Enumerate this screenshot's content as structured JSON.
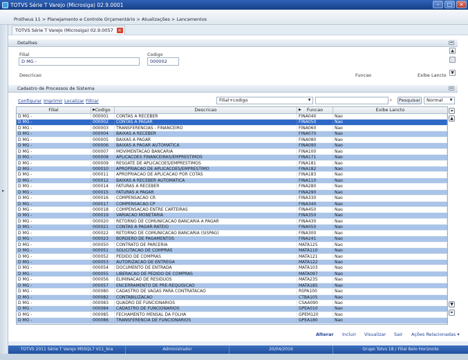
{
  "window": {
    "title": "TOTVS Série T Varejo (Microsiga) 02.9.0001"
  },
  "breadcrumb": "Protheus 11 > Planejamento e Controle Orçamentário > Atualizações > Lancamentos",
  "tab": {
    "label": "TOTVS Série T Varejo (Microsiga) 02.9.0057"
  },
  "detalhes": {
    "title": "Detalhes",
    "filial_label": "Filial",
    "filial_value": "D MG    -",
    "codigo_label": "Codigo",
    "codigo_value": "000002",
    "descricao_label": "Descricao",
    "funcao_label": "Funcao",
    "exibe_label": "Exibe Lancto"
  },
  "cadastro": {
    "title": "Cadastro de Processos de Sistema",
    "links": [
      "Configurar",
      "Imprimir",
      "Localizar",
      "Filtrar"
    ],
    "sort_select": "Filial+codigo",
    "search_value": "",
    "search_button": "Pesquisar",
    "view_select": "Normal"
  },
  "grid": {
    "columns": [
      "Filial",
      "Codigo",
      "Descricao",
      "Funcao",
      "Exibe Lancto"
    ],
    "rows": [
      [
        "D MG    -",
        "000001",
        "CONTAS A RECEBER",
        "FINA040",
        "Nao"
      ],
      [
        "D MG    -",
        "000002",
        "CONTAS A PAGAR",
        "FINA050",
        "Nao"
      ],
      [
        "D MG    -",
        "000003",
        "TRANSFERENCIAS - FINANCEIRO",
        "FINA060",
        "Nao"
      ],
      [
        "D MG    -",
        "000004",
        "BAIXAS A RECEBER",
        "FINA070",
        "Nao"
      ],
      [
        "D MG    -",
        "000005",
        "BAIXAS A PAGAR",
        "FINA080",
        "Nao"
      ],
      [
        "D MG    -",
        "000006",
        "BAIXAS A PAGAR AUTOMATICA",
        "FINA090",
        "Nao"
      ],
      [
        "D MG    -",
        "000007",
        "MOVIMENTACAO BANCARIA",
        "FINA100",
        "Nao"
      ],
      [
        "D MG    -",
        "000008",
        "APLICACOES FINANCEIRAS/EMPRESTIMOS",
        "FINA171",
        "Nao"
      ],
      [
        "D MG    -",
        "000009",
        "RESGATE DE APLICACOES/EMPRESTIMOS",
        "FINA181",
        "Nao"
      ],
      [
        "D MG    -",
        "000010",
        "APROPRIACAO DE APLICACOES/EMPRESTIMO",
        "FINA182",
        "Nao"
      ],
      [
        "D MG    -",
        "000011",
        "APROPRIACAO DE APLICACAO POR COTAS",
        "FINA183",
        "Nao"
      ],
      [
        "D MG    -",
        "000012",
        "BAIXAS A RECEBER AUTOMATICA",
        "FINA110",
        "Nao"
      ],
      [
        "D MG    -",
        "000014",
        "FATURAS A RECEBER",
        "FINA280",
        "Nao"
      ],
      [
        "D MG    -",
        "000015",
        "FATURAS A PAGAR",
        "FINA290",
        "Nao"
      ],
      [
        "D MG    -",
        "000016",
        "COMPENSACAO CR",
        "FINA330",
        "Nao"
      ],
      [
        "D MG    -",
        "000017",
        "COMPENSACAO CP",
        "FINA340",
        "Nao"
      ],
      [
        "D MG    -",
        "000018",
        "COMPENSACAO ENTRE CARTEIRAS",
        "FINA450",
        "Nao"
      ],
      [
        "D MG    -",
        "000019",
        "VARIACAO MONETARIA",
        "FINA350",
        "Nao"
      ],
      [
        "D MG    -",
        "000020",
        "RETORNO DE COMUNICACAO BANCARIA A PAGAR",
        "FINA430",
        "Nao"
      ],
      [
        "D MG    -",
        "000021",
        "CONTAS A PAGAR-RATEIO",
        "FINA050",
        "Nao"
      ],
      [
        "D MG    -",
        "000022",
        "RETORNO DE COMUNICACAO BANCARIA (SISPAG)",
        "FINA300",
        "Nao"
      ],
      [
        "D MG    -",
        "000023",
        "BORDERO DE PAGAMENTOS",
        "FINA241",
        "Nao"
      ],
      [
        "D MG    -",
        "000050",
        "CONTRATO DE PARCERIA",
        "MATA125",
        "Nao"
      ],
      [
        "D MG    -",
        "000051",
        "SOLICITACAO DE COMPRAS",
        "MATA110",
        "Nao"
      ],
      [
        "D MG    -",
        "000052",
        "PEDIDO DE COMPRAS",
        "MATA121",
        "Nao"
      ],
      [
        "D MG    -",
        "000053",
        "AUTORIZACAO DE ENTREGA",
        "MATA122",
        "Nao"
      ],
      [
        "D MG    -",
        "000054",
        "DOCUMENTO DE ENTRADA",
        "MATA103",
        "Nao"
      ],
      [
        "D MG    -",
        "000055",
        "LIBERACAO DE PEDIDO DE COMPRAS",
        "MATA097",
        "Nao"
      ],
      [
        "D MG    -",
        "000056",
        "ELIMINACAO DE RESIDUOS",
        "MATA235",
        "Nao"
      ],
      [
        "D MG    -",
        "000057",
        "ENCERRAMENTO DE PRE-REQUISICAO",
        "MATA185",
        "Nao"
      ],
      [
        "D MG    -",
        "000080",
        "CADASTRO DE VAGAS PARA CONTRATACAO",
        "RSPA100",
        "Nao"
      ],
      [
        "D MG    -",
        "000082",
        "CONTABILIZACAO",
        "CTBA105",
        "Nao"
      ],
      [
        "D MG    -",
        "000083",
        "QUADRO DE FUNCIONARIOS",
        "CSAA090",
        "Nao"
      ],
      [
        "D MG    -",
        "000084",
        "CADASTRO DE FUNCIONARIOS",
        "GPEA010",
        "Nao"
      ],
      [
        "D MG    -",
        "000085",
        "FECHAMENTO MENSAL DA FOLHA",
        "GPEM120",
        "Nao"
      ],
      [
        "D MG    -",
        "000086",
        "TRANSFERENCIA DE FUNCIONARIOS",
        "GPEA180",
        "Nao"
      ]
    ],
    "selected_row": 1
  },
  "footer": [
    "Alterar",
    "Incluir",
    "Visualizar",
    "Sair",
    "Ações Relacionadas"
  ],
  "status": [
    "TOTVS 2011 Série T Varejo MSSQL7 V11_bra",
    "Administrador",
    "20/04/2016",
    "Grupo Totvs 18 / Filial Belo Horizonte"
  ]
}
